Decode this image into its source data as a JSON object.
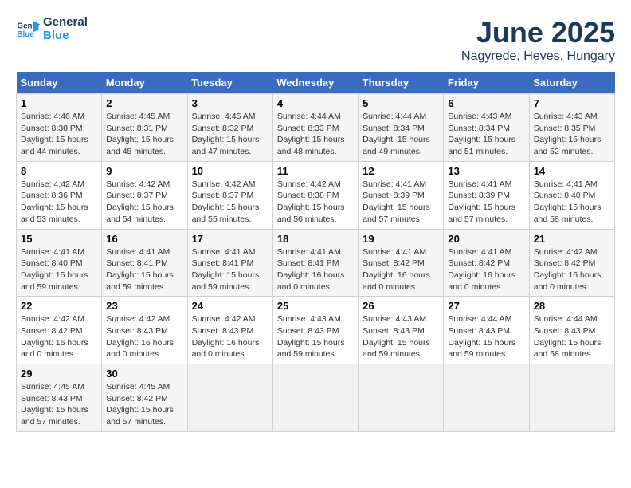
{
  "logo": {
    "line1": "General",
    "line2": "Blue"
  },
  "title": "June 2025",
  "subtitle": "Nagyrede, Heves, Hungary",
  "days_of_week": [
    "Sunday",
    "Monday",
    "Tuesday",
    "Wednesday",
    "Thursday",
    "Friday",
    "Saturday"
  ],
  "weeks": [
    [
      {
        "day": "1",
        "info": "Sunrise: 4:46 AM\nSunset: 8:30 PM\nDaylight: 15 hours\nand 44 minutes."
      },
      {
        "day": "2",
        "info": "Sunrise: 4:45 AM\nSunset: 8:31 PM\nDaylight: 15 hours\nand 45 minutes."
      },
      {
        "day": "3",
        "info": "Sunrise: 4:45 AM\nSunset: 8:32 PM\nDaylight: 15 hours\nand 47 minutes."
      },
      {
        "day": "4",
        "info": "Sunrise: 4:44 AM\nSunset: 8:33 PM\nDaylight: 15 hours\nand 48 minutes."
      },
      {
        "day": "5",
        "info": "Sunrise: 4:44 AM\nSunset: 8:34 PM\nDaylight: 15 hours\nand 49 minutes."
      },
      {
        "day": "6",
        "info": "Sunrise: 4:43 AM\nSunset: 8:34 PM\nDaylight: 15 hours\nand 51 minutes."
      },
      {
        "day": "7",
        "info": "Sunrise: 4:43 AM\nSunset: 8:35 PM\nDaylight: 15 hours\nand 52 minutes."
      }
    ],
    [
      {
        "day": "8",
        "info": "Sunrise: 4:42 AM\nSunset: 8:36 PM\nDaylight: 15 hours\nand 53 minutes."
      },
      {
        "day": "9",
        "info": "Sunrise: 4:42 AM\nSunset: 8:37 PM\nDaylight: 15 hours\nand 54 minutes."
      },
      {
        "day": "10",
        "info": "Sunrise: 4:42 AM\nSunset: 8:37 PM\nDaylight: 15 hours\nand 55 minutes."
      },
      {
        "day": "11",
        "info": "Sunrise: 4:42 AM\nSunset: 8:38 PM\nDaylight: 15 hours\nand 56 minutes."
      },
      {
        "day": "12",
        "info": "Sunrise: 4:41 AM\nSunset: 8:39 PM\nDaylight: 15 hours\nand 57 minutes."
      },
      {
        "day": "13",
        "info": "Sunrise: 4:41 AM\nSunset: 8:39 PM\nDaylight: 15 hours\nand 57 minutes."
      },
      {
        "day": "14",
        "info": "Sunrise: 4:41 AM\nSunset: 8:40 PM\nDaylight: 15 hours\nand 58 minutes."
      }
    ],
    [
      {
        "day": "15",
        "info": "Sunrise: 4:41 AM\nSunset: 8:40 PM\nDaylight: 15 hours\nand 59 minutes."
      },
      {
        "day": "16",
        "info": "Sunrise: 4:41 AM\nSunset: 8:41 PM\nDaylight: 15 hours\nand 59 minutes."
      },
      {
        "day": "17",
        "info": "Sunrise: 4:41 AM\nSunset: 8:41 PM\nDaylight: 15 hours\nand 59 minutes."
      },
      {
        "day": "18",
        "info": "Sunrise: 4:41 AM\nSunset: 8:41 PM\nDaylight: 16 hours\nand 0 minutes."
      },
      {
        "day": "19",
        "info": "Sunrise: 4:41 AM\nSunset: 8:42 PM\nDaylight: 16 hours\nand 0 minutes."
      },
      {
        "day": "20",
        "info": "Sunrise: 4:41 AM\nSunset: 8:42 PM\nDaylight: 16 hours\nand 0 minutes."
      },
      {
        "day": "21",
        "info": "Sunrise: 4:42 AM\nSunset: 8:42 PM\nDaylight: 16 hours\nand 0 minutes."
      }
    ],
    [
      {
        "day": "22",
        "info": "Sunrise: 4:42 AM\nSunset: 8:42 PM\nDaylight: 16 hours\nand 0 minutes."
      },
      {
        "day": "23",
        "info": "Sunrise: 4:42 AM\nSunset: 8:43 PM\nDaylight: 16 hours\nand 0 minutes."
      },
      {
        "day": "24",
        "info": "Sunrise: 4:42 AM\nSunset: 8:43 PM\nDaylight: 16 hours\nand 0 minutes."
      },
      {
        "day": "25",
        "info": "Sunrise: 4:43 AM\nSunset: 8:43 PM\nDaylight: 15 hours\nand 59 minutes."
      },
      {
        "day": "26",
        "info": "Sunrise: 4:43 AM\nSunset: 8:43 PM\nDaylight: 15 hours\nand 59 minutes."
      },
      {
        "day": "27",
        "info": "Sunrise: 4:44 AM\nSunset: 8:43 PM\nDaylight: 15 hours\nand 59 minutes."
      },
      {
        "day": "28",
        "info": "Sunrise: 4:44 AM\nSunset: 8:43 PM\nDaylight: 15 hours\nand 58 minutes."
      }
    ],
    [
      {
        "day": "29",
        "info": "Sunrise: 4:45 AM\nSunset: 8:43 PM\nDaylight: 15 hours\nand 57 minutes."
      },
      {
        "day": "30",
        "info": "Sunrise: 4:45 AM\nSunset: 8:42 PM\nDaylight: 15 hours\nand 57 minutes."
      },
      {
        "day": "",
        "info": ""
      },
      {
        "day": "",
        "info": ""
      },
      {
        "day": "",
        "info": ""
      },
      {
        "day": "",
        "info": ""
      },
      {
        "day": "",
        "info": ""
      }
    ]
  ]
}
